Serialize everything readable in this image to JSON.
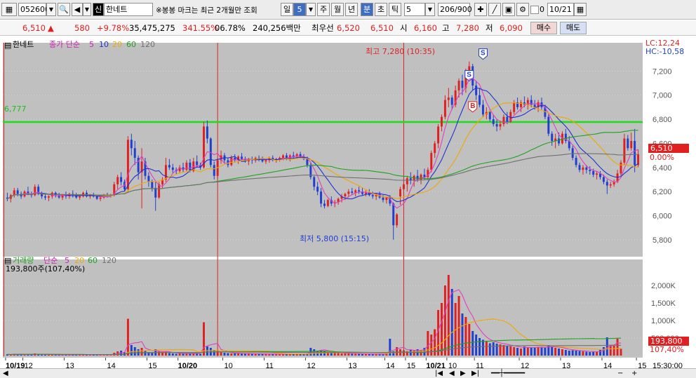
{
  "toolbar": {
    "code": "052600",
    "credit_badge": "신",
    "stock_name": "한네트",
    "notice": "※봉봉 마크는 최근 2개월만 조회",
    "period_tabs": [
      "일",
      "5",
      "주",
      "월",
      "년",
      "분",
      "초",
      "틱"
    ],
    "interval": "5",
    "count": "206/900",
    "checkbox_label": "0",
    "date": "10/21"
  },
  "quote": {
    "price": "6,510",
    "change": "580",
    "rate": "+9.78%",
    "volume": "35,475,275",
    "vol_ratio": "341.55%",
    "turnover": "06.78%",
    "amount": "240,256백만",
    "bid_label": "최우선",
    "bid1": "6,520",
    "bid2": "6,510",
    "open_label": "시",
    "open": "6,160",
    "high_label": "고",
    "high": "7,280",
    "low_label": "저",
    "low": "6,090",
    "buy_label": "매수",
    "sell_label": "매도"
  },
  "price_panel": {
    "name": "한네트",
    "ma_label": "종가 단순",
    "ma_periods": [
      "5",
      "10",
      "20",
      "60",
      "120"
    ],
    "hline_value": "6,777",
    "hline_color": "#19e019",
    "lc_label": "LC:12,24",
    "hc_label": "HC:-10,58",
    "high_annotation": "최고 7,280 (10:35)",
    "low_annotation": "최저 5,800 (15:15)",
    "current_tag": "6,510",
    "current_pct": "0.00%",
    "y_ticks": [
      "7,200",
      "7,000",
      "6,800",
      "6,600",
      "6,400",
      "6,200",
      "6,000",
      "5,800"
    ],
    "markers": [
      "S",
      "S",
      "B"
    ]
  },
  "volume_panel": {
    "name": "거래량",
    "ma_label": "단순",
    "ma_periods": [
      "5",
      "20",
      "60",
      "120"
    ],
    "info": "193,800주(107,40%)",
    "current_tag": "193,800",
    "current_pct": "107,40%",
    "y_ticks": [
      "2,000K",
      "1,500K",
      "1,000K",
      "500,000"
    ]
  },
  "x_axis": {
    "labels": [
      "10/19",
      "12",
      "13",
      "14",
      "15",
      "10/20",
      "10",
      "11",
      "12",
      "13",
      "14",
      "15",
      "10/21",
      "10",
      "11",
      "12",
      "13",
      "14",
      "15"
    ],
    "time": "15:30:00"
  },
  "colors": {
    "up": "#e02020",
    "down": "#1f3fd0",
    "ma5": "#e040c0",
    "ma10": "#2030d0",
    "ma20": "#f0a800",
    "ma60": "#20a020",
    "ma120": "#707070"
  },
  "chart_data": {
    "type": "candlestick",
    "ohlc": [
      [
        6150,
        6190,
        6120,
        6140
      ],
      [
        6140,
        6180,
        6110,
        6170
      ],
      [
        6170,
        6230,
        6150,
        6210
      ],
      [
        6210,
        6230,
        6160,
        6180
      ],
      [
        6180,
        6200,
        6140,
        6160
      ],
      [
        6160,
        6210,
        6150,
        6200
      ],
      [
        6200,
        6240,
        6170,
        6180
      ],
      [
        6180,
        6200,
        6150,
        6170
      ],
      [
        6170,
        6260,
        6160,
        6240
      ],
      [
        6240,
        6260,
        6170,
        6180
      ],
      [
        6180,
        6200,
        6140,
        6160
      ],
      [
        6160,
        6180,
        6130,
        6150
      ],
      [
        6150,
        6170,
        6120,
        6160
      ],
      [
        6160,
        6200,
        6140,
        6190
      ],
      [
        6190,
        6200,
        6150,
        6170
      ],
      [
        6170,
        6190,
        6140,
        6150
      ],
      [
        6150,
        6180,
        6130,
        6170
      ],
      [
        6170,
        6200,
        6140,
        6160
      ],
      [
        6160,
        6190,
        6140,
        6180
      ],
      [
        6180,
        6210,
        6150,
        6170
      ],
      [
        6170,
        6190,
        6140,
        6150
      ],
      [
        6150,
        6170,
        6130,
        6160
      ],
      [
        6160,
        6200,
        6150,
        6190
      ],
      [
        6190,
        6210,
        6150,
        6160
      ],
      [
        6160,
        6180,
        6140,
        6170
      ],
      [
        6170,
        6190,
        6150,
        6160
      ],
      [
        6160,
        6170,
        6130,
        6140
      ],
      [
        6140,
        6160,
        6120,
        6150
      ],
      [
        6150,
        6180,
        6140,
        6170
      ],
      [
        6170,
        6190,
        6150,
        6160
      ],
      [
        6160,
        6180,
        6150,
        6170
      ],
      [
        6170,
        6280,
        6160,
        6260
      ],
      [
        6260,
        6340,
        6220,
        6320
      ],
      [
        6320,
        6360,
        6250,
        6280
      ],
      [
        6280,
        6300,
        6200,
        6220
      ],
      [
        6220,
        6660,
        6200,
        6630
      ],
      [
        6630,
        6680,
        6500,
        6560
      ],
      [
        6560,
        6620,
        6420,
        6480
      ],
      [
        6480,
        6500,
        6300,
        6360
      ],
      [
        6360,
        6560,
        6060,
        6450
      ],
      [
        6450,
        6480,
        6300,
        6330
      ],
      [
        6330,
        6360,
        6240,
        6280
      ],
      [
        6280,
        6300,
        6200,
        6230
      ],
      [
        6230,
        6280,
        6040,
        6150
      ],
      [
        6150,
        6280,
        6140,
        6260
      ],
      [
        6260,
        6320,
        6230,
        6300
      ],
      [
        6300,
        6480,
        6280,
        6420
      ],
      [
        6420,
        6470,
        6380,
        6400
      ],
      [
        6400,
        6430,
        6350,
        6380
      ],
      [
        6380,
        6400,
        6340,
        6370
      ],
      [
        6370,
        6420,
        6350,
        6400
      ],
      [
        6400,
        6440,
        6360,
        6380
      ],
      [
        6380,
        6460,
        6370,
        6440
      ],
      [
        6440,
        6470,
        6360,
        6370
      ],
      [
        6370,
        6480,
        6360,
        6450
      ],
      [
        6450,
        6500,
        6400,
        6420
      ],
      [
        6420,
        6440,
        6380,
        6400
      ],
      [
        6400,
        6780,
        6390,
        6740
      ],
      [
        6740,
        6790,
        6600,
        6640
      ],
      [
        6640,
        6650,
        6400,
        6420
      ],
      [
        6420,
        6450,
        6300,
        6330
      ],
      [
        6330,
        6480,
        6310,
        6460
      ],
      [
        6460,
        6540,
        6430,
        6500
      ],
      [
        6500,
        6520,
        6440,
        6460
      ],
      [
        6460,
        6480,
        6400,
        6420
      ],
      [
        6420,
        6500,
        6410,
        6480
      ],
      [
        6480,
        6510,
        6440,
        6460
      ],
      [
        6460,
        6500,
        6430,
        6490
      ],
      [
        6490,
        6520,
        6450,
        6470
      ],
      [
        6470,
        6490,
        6440,
        6450
      ],
      [
        6450,
        6480,
        6420,
        6470
      ],
      [
        6470,
        6490,
        6430,
        6460
      ],
      [
        6460,
        6490,
        6440,
        6480
      ],
      [
        6480,
        6500,
        6450,
        6470
      ],
      [
        6470,
        6490,
        6440,
        6450
      ],
      [
        6450,
        6470,
        6430,
        6460
      ],
      [
        6460,
        6490,
        6440,
        6480
      ],
      [
        6480,
        6500,
        6450,
        6460
      ],
      [
        6460,
        6480,
        6440,
        6470
      ],
      [
        6470,
        6490,
        6450,
        6480
      ],
      [
        6480,
        6510,
        6460,
        6500
      ],
      [
        6500,
        6520,
        6460,
        6470
      ],
      [
        6470,
        6510,
        6450,
        6500
      ],
      [
        6500,
        6530,
        6470,
        6490
      ],
      [
        6490,
        6520,
        6470,
        6510
      ],
      [
        6510,
        6530,
        6480,
        6490
      ],
      [
        6490,
        6510,
        6460,
        6470
      ],
      [
        6470,
        6490,
        6400,
        6420
      ],
      [
        6420,
        6440,
        6300,
        6320
      ],
      [
        6320,
        6330,
        6210,
        6240
      ],
      [
        6240,
        6280,
        6170,
        6200
      ],
      [
        6200,
        6230,
        6070,
        6100
      ],
      [
        6100,
        6130,
        6060,
        6080
      ],
      [
        6080,
        6140,
        6070,
        6130
      ],
      [
        6130,
        6160,
        6080,
        6100
      ],
      [
        6100,
        6130,
        6070,
        6110
      ],
      [
        6110,
        6150,
        6090,
        6140
      ],
      [
        6140,
        6180,
        6110,
        6160
      ],
      [
        6160,
        6190,
        6130,
        6180
      ],
      [
        6180,
        6220,
        6150,
        6200
      ],
      [
        6200,
        6230,
        6170,
        6190
      ],
      [
        6190,
        6220,
        6160,
        6210
      ],
      [
        6210,
        6240,
        6180,
        6200
      ],
      [
        6200,
        6230,
        6170,
        6180
      ],
      [
        6180,
        6210,
        6160,
        6190
      ],
      [
        6190,
        6220,
        6160,
        6170
      ],
      [
        6170,
        6200,
        6140,
        6160
      ],
      [
        6160,
        6190,
        6130,
        6180
      ],
      [
        6180,
        6200,
        6140,
        6150
      ],
      [
        6150,
        6170,
        6110,
        6130
      ],
      [
        6130,
        6160,
        6100,
        6150
      ],
      [
        6150,
        6170,
        6080,
        6100
      ],
      [
        6100,
        6110,
        5800,
        5920
      ],
      [
        5920,
        6020,
        5900,
        6010
      ],
      [
        6160,
        6240,
        6090,
        6220
      ],
      [
        6220,
        6290,
        6180,
        6260
      ],
      [
        6260,
        6330,
        6200,
        6310
      ],
      [
        6310,
        6360,
        6260,
        6290
      ],
      [
        6290,
        6340,
        6240,
        6330
      ],
      [
        6330,
        6380,
        6280,
        6300
      ],
      [
        6300,
        6350,
        6260,
        6340
      ],
      [
        6340,
        6390,
        6300,
        6320
      ],
      [
        6320,
        6400,
        6300,
        6380
      ],
      [
        6380,
        6540,
        6360,
        6520
      ],
      [
        6520,
        6620,
        6480,
        6600
      ],
      [
        6600,
        6760,
        6560,
        6740
      ],
      [
        6740,
        6840,
        6700,
        6820
      ],
      [
        6820,
        7000,
        6800,
        6960
      ],
      [
        6960,
        7060,
        6900,
        6980
      ],
      [
        6980,
        7000,
        6880,
        6920
      ],
      [
        6920,
        7080,
        6900,
        7040
      ],
      [
        7040,
        7140,
        6980,
        7120
      ],
      [
        7120,
        7170,
        7000,
        7060
      ],
      [
        7060,
        7220,
        7020,
        7200
      ],
      [
        7200,
        7280,
        7120,
        7240
      ],
      [
        7240,
        7260,
        7040,
        7080
      ],
      [
        7080,
        7120,
        6960,
        7000
      ],
      [
        7000,
        7060,
        6900,
        6920
      ],
      [
        6920,
        6960,
        6820,
        6840
      ],
      [
        6840,
        6900,
        6800,
        6860
      ],
      [
        6860,
        6880,
        6780,
        6800
      ],
      [
        6800,
        6840,
        6740,
        6760
      ],
      [
        6760,
        6800,
        6700,
        6740
      ],
      [
        6740,
        6780,
        6710,
        6760
      ],
      [
        6760,
        6840,
        6740,
        6820
      ],
      [
        6820,
        6860,
        6760,
        6780
      ],
      [
        6780,
        6880,
        6770,
        6860
      ],
      [
        6860,
        6960,
        6840,
        6940
      ],
      [
        6940,
        6980,
        6880,
        6900
      ],
      [
        6900,
        6960,
        6860,
        6940
      ],
      [
        6940,
        6990,
        6900,
        6920
      ],
      [
        6920,
        6980,
        6880,
        6960
      ],
      [
        6960,
        7000,
        6900,
        6920
      ],
      [
        6920,
        6960,
        6880,
        6900
      ],
      [
        6900,
        6960,
        6860,
        6940
      ],
      [
        6940,
        6980,
        6880,
        6900
      ],
      [
        6900,
        6920,
        6800,
        6820
      ],
      [
        6820,
        6840,
        6660,
        6680
      ],
      [
        6680,
        6700,
        6580,
        6620
      ],
      [
        6620,
        6680,
        6560,
        6640
      ],
      [
        6640,
        6690,
        6580,
        6600
      ],
      [
        6600,
        6700,
        6590,
        6680
      ],
      [
        6680,
        6720,
        6600,
        6620
      ],
      [
        6620,
        6660,
        6540,
        6560
      ],
      [
        6560,
        6580,
        6460,
        6480
      ],
      [
        6480,
        6500,
        6400,
        6420
      ],
      [
        6420,
        6440,
        6360,
        6380
      ],
      [
        6380,
        6420,
        6340,
        6400
      ],
      [
        6400,
        6420,
        6350,
        6380
      ],
      [
        6380,
        6410,
        6340,
        6370
      ],
      [
        6370,
        6390,
        6320,
        6340
      ],
      [
        6340,
        6370,
        6300,
        6350
      ],
      [
        6350,
        6370,
        6300,
        6320
      ],
      [
        6320,
        6340,
        6260,
        6280
      ],
      [
        6280,
        6300,
        6180,
        6250
      ],
      [
        6250,
        6280,
        6230,
        6260
      ],
      [
        6260,
        6300,
        6240,
        6280
      ],
      [
        6280,
        6380,
        6270,
        6350
      ],
      [
        6350,
        6460,
        6330,
        6440
      ],
      [
        6440,
        6680,
        6420,
        6640
      ],
      [
        6640,
        6670,
        6540,
        6560
      ],
      [
        6560,
        6690,
        6540,
        6620
      ],
      [
        6620,
        6720,
        6360,
        6420
      ],
      [
        6420,
        6550,
        6400,
        6510
      ]
    ],
    "volume": [
      36000,
      24000,
      48000,
      30000,
      42000,
      28000,
      36000,
      32000,
      60000,
      40000,
      26000,
      22000,
      30000,
      28000,
      24000,
      26000,
      22000,
      28000,
      30000,
      26000,
      24000,
      22000,
      30000,
      28000,
      24000,
      26000,
      22000,
      20000,
      24000,
      26000,
      30000,
      80000,
      120000,
      140000,
      90000,
      1050000,
      300000,
      240000,
      180000,
      220000,
      130000,
      100000,
      90000,
      180000,
      110000,
      80000,
      120000,
      70000,
      60000,
      50000,
      60000,
      55000,
      70000,
      50000,
      65000,
      60000,
      45000,
      950000,
      260000,
      220000,
      160000,
      140000,
      90000,
      80000,
      70000,
      60000,
      65000,
      60000,
      55000,
      50000,
      55000,
      52000,
      48000,
      50000,
      45000,
      46000,
      44000,
      42000,
      40000,
      42000,
      45000,
      40000,
      48000,
      44000,
      46000,
      42000,
      40000,
      60000,
      220000,
      180000,
      140000,
      160000,
      120000,
      100000,
      90000,
      80000,
      70000,
      60000,
      65000,
      60000,
      55000,
      52000,
      50000,
      48000,
      46000,
      45000,
      44000,
      42000,
      40000,
      42000,
      60000,
      480000,
      120000,
      240000,
      180000,
      150000,
      120000,
      160000,
      140000,
      180000,
      150000,
      220000,
      700000,
      600000,
      750000,
      1300000,
      1500000,
      2000000,
      2300000,
      1900000,
      1500000,
      1700000,
      1200000,
      1100000,
      900000,
      700000,
      600000,
      500000,
      450000,
      400000,
      350000,
      380000,
      340000,
      320000,
      300000,
      280000,
      260000,
      240000,
      220000,
      200000,
      260000,
      240000,
      230000,
      220000,
      250000,
      240000,
      220000,
      300000,
      260000,
      220000,
      200000,
      180000,
      160000,
      140000,
      150000,
      140000,
      130000,
      120000,
      110000,
      100000,
      110000,
      120000,
      160000,
      240000,
      520000,
      300000,
      280000,
      480000,
      193800
    ],
    "ylim_price": [
      5700,
      7400
    ],
    "ylim_volume": [
      0,
      2600000
    ]
  }
}
